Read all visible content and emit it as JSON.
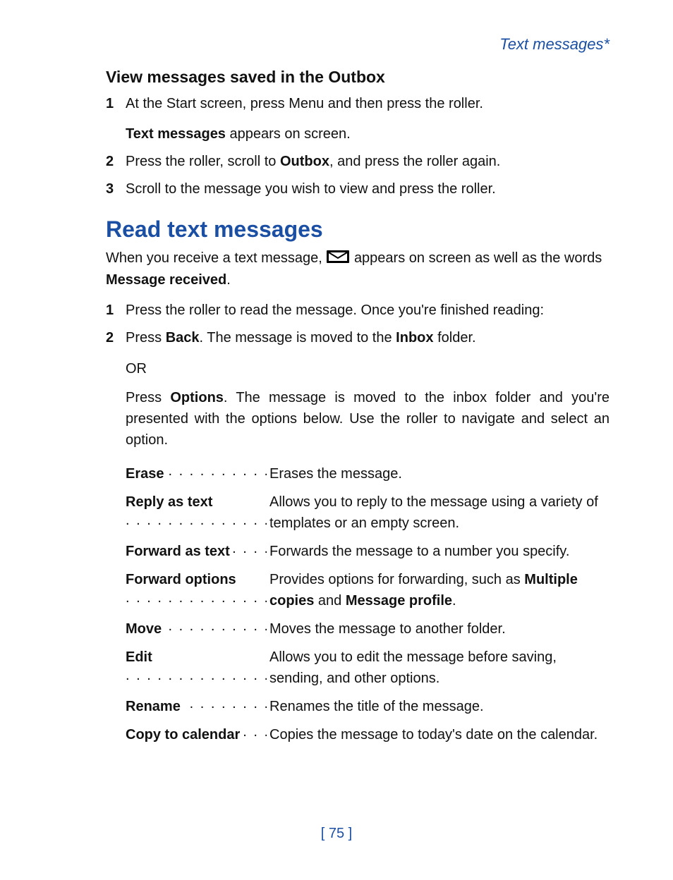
{
  "header": {
    "running_title": "Text messages*"
  },
  "section_view": {
    "heading": "View messages saved in the Outbox",
    "steps": [
      {
        "num": "1",
        "text_before": "At the Start screen, press Menu and then press the roller.",
        "followup_bold": "Text messages",
        "followup_rest": " appears on screen."
      },
      {
        "num": "2",
        "text_before": "Press the roller, scroll to ",
        "bold_mid": "Outbox",
        "text_after": ", and press the roller again."
      },
      {
        "num": "3",
        "text_before": "Scroll to the message you wish to view and press the roller."
      }
    ]
  },
  "section_read": {
    "heading": "Read text messages",
    "intro_before_icon": "When you receive a text message, ",
    "intro_after_icon": " appears on screen as well as the words ",
    "intro_bold_tail": "Message received",
    "intro_tail_punct": ".",
    "steps": [
      {
        "num": "1",
        "text": "Press the roller to read the message. Once you're finished reading:"
      },
      {
        "num": "2",
        "pre": "Press ",
        "bold1": "Back",
        "mid": ". The message is moved to the ",
        "bold2": "Inbox",
        "post": " folder."
      }
    ],
    "or_label": "OR",
    "trail_pre": "Press ",
    "trail_bold": "Options",
    "trail_post": ". The message is moved to the inbox folder and you're presented with the options below. Use the roller to navigate and select an option.",
    "options": [
      {
        "label": "Erase",
        "desc": "Erases the message."
      },
      {
        "label": "Reply as text",
        "desc": "Allows you to reply to the message using a variety of templates or an empty screen."
      },
      {
        "label": "Forward as text",
        "desc": "Forwards the message to a number you specify."
      },
      {
        "label": "Forward options",
        "desc_pre": "Provides options for forwarding, such as ",
        "desc_bold1": "Multiple copies",
        "desc_mid": " and ",
        "desc_bold2": "Message profile",
        "desc_post": "."
      },
      {
        "label": "Move",
        "desc": "Moves the message to another folder."
      },
      {
        "label": "Edit",
        "desc": "Allows you to edit the message before saving, sending, and other options."
      },
      {
        "label": "Rename",
        "desc": "Renames the title of the message."
      },
      {
        "label": "Copy to calendar",
        "desc": "Copies the message to today's date on the calendar."
      }
    ]
  },
  "footer": {
    "page_number": "75",
    "left_bracket": "[ ",
    "right_bracket": " ]"
  },
  "icons": {
    "envelope_name": "envelope-icon"
  }
}
